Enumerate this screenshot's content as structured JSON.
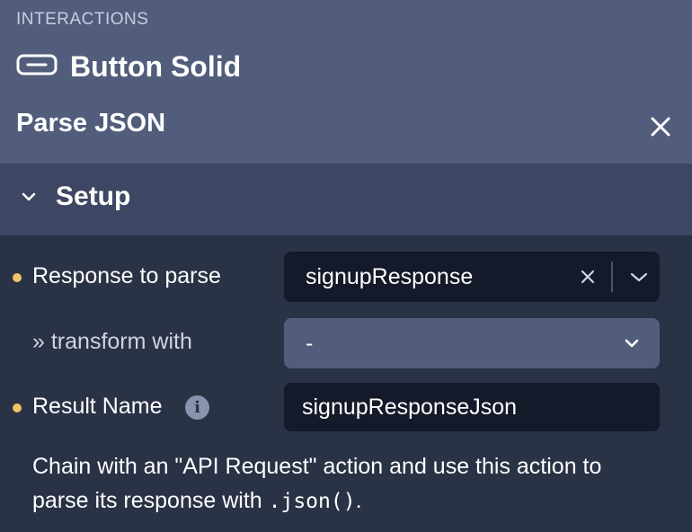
{
  "header": {
    "section_kicker": "INTERACTIONS",
    "component_name": "Button Solid",
    "component_icon": "button-icon",
    "action_title": "Parse JSON",
    "close_icon": "close-icon"
  },
  "setup": {
    "label": "Setup",
    "chevron_icon": "chevron-down-icon",
    "expanded": true
  },
  "fields": {
    "response_to_parse": {
      "label": "Response to parse",
      "value": "signupResponse",
      "required": true
    },
    "transform_with": {
      "prefix": "»",
      "label": "transform with",
      "value": "-"
    },
    "result_name": {
      "label": "Result Name",
      "value": "signupResponseJson",
      "required": true,
      "info_icon": "info-icon"
    }
  },
  "help": {
    "text_before": "Chain with an \"API Request\" action and use this action to parse its response with ",
    "code": ".json()",
    "text_after": "."
  },
  "colors": {
    "header_bg": "#525d7b",
    "setup_bg": "#3d4662",
    "body_bg": "#2a3246",
    "input_dark": "#141a29",
    "required_dot": "#f0c36b"
  }
}
